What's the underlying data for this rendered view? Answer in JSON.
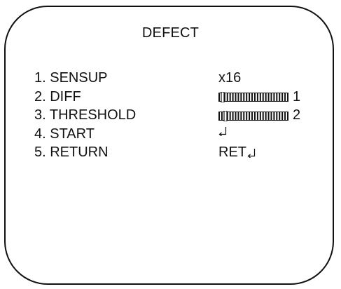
{
  "menu": {
    "title": "DEFECT",
    "items": [
      {
        "label": "1. SENSUP",
        "value": "x16"
      },
      {
        "label": "2. DIFF",
        "slider_level": 1,
        "slider_text": "1"
      },
      {
        "label": "3. THRESHOLD",
        "slider_level": 2,
        "slider_text": "2"
      },
      {
        "label": "4. START",
        "icon": "enter-icon"
      },
      {
        "label": "5. RETURN",
        "value": "RET",
        "icon": "enter-icon"
      }
    ]
  }
}
